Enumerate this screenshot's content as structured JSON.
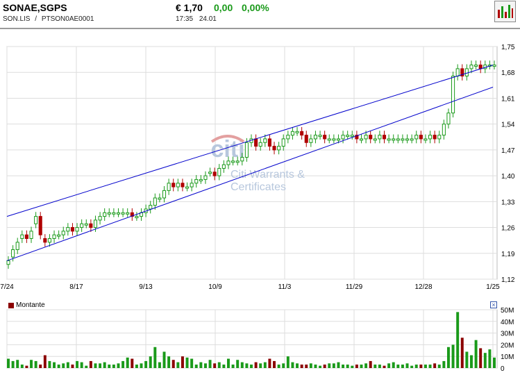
{
  "header": {
    "name": "SONAE,SGPS",
    "ticker": "SON.LIS",
    "separator": "/",
    "isin": "PTSON0AE0001",
    "price": "€ 1,70",
    "change": "0,00",
    "change_pct": "0,00%",
    "time": "17:35",
    "date": "24.01"
  },
  "colors": {
    "up": "#1a9a1a",
    "down": "#b00000",
    "channel": "#0000cc",
    "volume_down": "#8b0000",
    "watermark": "#b7c7dd"
  },
  "watermark": {
    "brand": "citi",
    "line1": "Citi Warrants &",
    "line2": "Certificates"
  },
  "volume_legend": {
    "label": "Montante"
  },
  "chart_data": [
    {
      "type": "candlestick",
      "x_ticks": [
        "7/24",
        "8/17",
        "9/13",
        "10/9",
        "11/3",
        "11/29",
        "12/28",
        "1/25"
      ],
      "y_ticks": [
        "1,75",
        "1,68",
        "1,61",
        "1,54",
        "1,47",
        "1,40",
        "1,33",
        "1,26",
        "1,19",
        "1,12"
      ],
      "ylim": [
        1.12,
        1.75
      ],
      "grid": true,
      "closes": [
        1.17,
        1.2,
        1.22,
        1.24,
        1.23,
        1.25,
        1.29,
        1.24,
        1.22,
        1.23,
        1.24,
        1.24,
        1.25,
        1.26,
        1.25,
        1.26,
        1.27,
        1.27,
        1.26,
        1.28,
        1.29,
        1.3,
        1.3,
        1.3,
        1.3,
        1.3,
        1.3,
        1.29,
        1.29,
        1.3,
        1.31,
        1.32,
        1.34,
        1.34,
        1.36,
        1.38,
        1.37,
        1.38,
        1.37,
        1.37,
        1.38,
        1.39,
        1.39,
        1.4,
        1.41,
        1.4,
        1.42,
        1.43,
        1.44,
        1.44,
        1.44,
        1.45,
        1.49,
        1.5,
        1.48,
        1.49,
        1.5,
        1.48,
        1.47,
        1.48,
        1.5,
        1.51,
        1.52,
        1.52,
        1.51,
        1.49,
        1.5,
        1.51,
        1.51,
        1.5,
        1.5,
        1.5,
        1.5,
        1.51,
        1.51,
        1.51,
        1.5,
        1.5,
        1.51,
        1.5,
        1.5,
        1.51,
        1.5,
        1.5,
        1.5,
        1.5,
        1.5,
        1.5,
        1.5,
        1.51,
        1.5,
        1.5,
        1.51,
        1.5,
        1.51,
        1.54,
        1.57,
        1.67,
        1.69,
        1.67,
        1.69,
        1.7,
        1.7,
        1.69,
        1.7,
        1.7,
        1.7
      ],
      "opens": [
        1.16,
        1.18,
        1.2,
        1.23,
        1.24,
        1.23,
        1.27,
        1.29,
        1.23,
        1.22,
        1.23,
        1.24,
        1.24,
        1.25,
        1.26,
        1.25,
        1.26,
        1.27,
        1.27,
        1.26,
        1.28,
        1.29,
        1.3,
        1.3,
        1.3,
        1.3,
        1.3,
        1.3,
        1.29,
        1.29,
        1.3,
        1.31,
        1.32,
        1.34,
        1.34,
        1.36,
        1.38,
        1.37,
        1.38,
        1.37,
        1.37,
        1.38,
        1.39,
        1.39,
        1.41,
        1.41,
        1.4,
        1.42,
        1.43,
        1.44,
        1.44,
        1.44,
        1.45,
        1.49,
        1.5,
        1.48,
        1.49,
        1.5,
        1.48,
        1.47,
        1.48,
        1.5,
        1.51,
        1.52,
        1.52,
        1.51,
        1.49,
        1.5,
        1.51,
        1.51,
        1.5,
        1.5,
        1.5,
        1.5,
        1.51,
        1.51,
        1.51,
        1.5,
        1.5,
        1.51,
        1.5,
        1.5,
        1.51,
        1.5,
        1.5,
        1.5,
        1.5,
        1.5,
        1.5,
        1.5,
        1.51,
        1.5,
        1.5,
        1.51,
        1.5,
        1.51,
        1.54,
        1.57,
        1.67,
        1.69,
        1.67,
        1.69,
        1.7,
        1.7,
        1.69,
        1.7
      ],
      "channel": {
        "upper": [
          {
            "x": "7/24",
            "y": 1.29
          },
          {
            "x": "1/25",
            "y": 1.7
          }
        ],
        "lower": [
          {
            "x": "7/24",
            "y": 1.17
          },
          {
            "x": "1/25",
            "y": 1.64
          }
        ]
      }
    },
    {
      "type": "bar",
      "name": "Montante",
      "y_ticks": [
        "50M",
        "40M",
        "30M",
        "20M",
        "10M",
        "0"
      ],
      "ylim": [
        0,
        50
      ],
      "values": [
        8,
        6,
        7,
        3,
        2,
        7,
        6,
        3,
        11,
        6,
        5,
        3,
        4,
        5,
        3,
        6,
        5,
        2,
        6,
        4,
        4,
        5,
        3,
        3,
        4,
        6,
        9,
        8,
        3,
        4,
        6,
        10,
        18,
        5,
        14,
        10,
        7,
        5,
        10,
        9,
        8,
        3,
        5,
        4,
        7,
        4,
        5,
        3,
        8,
        3,
        7,
        5,
        4,
        3,
        5,
        4,
        5,
        8,
        6,
        3,
        4,
        10,
        5,
        4,
        3,
        3,
        4,
        3,
        2,
        3,
        4,
        4,
        5,
        3,
        3,
        2,
        3,
        3,
        4,
        6,
        3,
        3,
        2,
        4,
        5,
        3,
        3,
        4,
        2,
        3,
        3,
        3,
        3,
        4,
        3,
        6,
        18,
        20,
        48,
        26,
        14,
        11,
        24,
        17,
        13,
        16,
        9
      ]
    }
  ]
}
